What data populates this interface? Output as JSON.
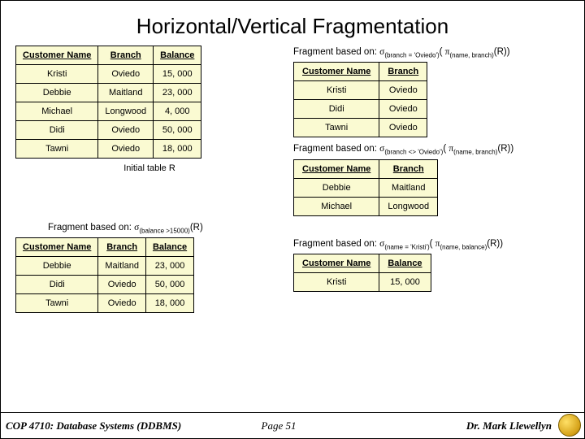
{
  "title": "Horizontal/Vertical Fragmentation",
  "frag1_caption_pre": "Fragment based on: ",
  "frag1_sel": "σ",
  "frag1_sel_sub": "(branch = 'Oviedo')",
  "frag1_proj": "π",
  "frag1_proj_sub": "(name, branch)",
  "frag1_tail": "(R))",
  "table_R": {
    "h1": "Customer Name",
    "h2": "Branch",
    "h3": "Balance",
    "rows": [
      {
        "c1": "Kristi",
        "c2": "Oviedo",
        "c3": "15, 000"
      },
      {
        "c1": "Debbie",
        "c2": "Maitland",
        "c3": "23, 000"
      },
      {
        "c1": "Michael",
        "c2": "Longwood",
        "c3": "4, 000"
      },
      {
        "c1": "Didi",
        "c2": "Oviedo",
        "c3": "50, 000"
      },
      {
        "c1": "Tawni",
        "c2": "Oviedo",
        "c3": "18, 000"
      }
    ],
    "caption": "Initial table R"
  },
  "frag_oviedo": {
    "h1": "Customer Name",
    "h2": "Branch",
    "rows": [
      {
        "c1": "Kristi",
        "c2": "Oviedo"
      },
      {
        "c1": "Didi",
        "c2": "Oviedo"
      },
      {
        "c1": "Tawni",
        "c2": "Oviedo"
      }
    ]
  },
  "frag2_caption_pre": "Fragment based on: ",
  "frag2_sel": "σ",
  "frag2_sel_sub": "(branch <> 'Oviedo')",
  "frag2_proj": "π",
  "frag2_proj_sub": "(name, branch)",
  "frag2_tail": "(R))",
  "frag_notoviedo": {
    "h1": "Customer Name",
    "h2": "Branch",
    "rows": [
      {
        "c1": "Debbie",
        "c2": "Maitland"
      },
      {
        "c1": "Michael",
        "c2": "Longwood"
      }
    ]
  },
  "frag3_caption_pre": "Fragment based on: ",
  "frag3_sel": "σ",
  "frag3_sel_sub": "(balance >15000)",
  "frag3_tail": "(R)",
  "frag_bal": {
    "h1": "Customer Name",
    "h2": "Branch",
    "h3": "Balance",
    "rows": [
      {
        "c1": "Debbie",
        "c2": "Maitland",
        "c3": "23, 000"
      },
      {
        "c1": "Didi",
        "c2": "Oviedo",
        "c3": "50, 000"
      },
      {
        "c1": "Tawni",
        "c2": "Oviedo",
        "c3": "18, 000"
      }
    ]
  },
  "frag4_caption_pre": "Fragment based on: ",
  "frag4_sel": "σ",
  "frag4_sel_sub": "(name = 'Kristi')",
  "frag4_proj": "π",
  "frag4_proj_sub": "(name, balance)",
  "frag4_tail": "(R))",
  "frag_kristi": {
    "h1": "Customer Name",
    "h2": "Balance",
    "rows": [
      {
        "c1": "Kristi",
        "c2": "15, 000"
      }
    ]
  },
  "footer": {
    "course": "COP 4710: Database Systems  (DDBMS)",
    "page": "Page 51",
    "author": "Dr. Mark Llewellyn"
  }
}
